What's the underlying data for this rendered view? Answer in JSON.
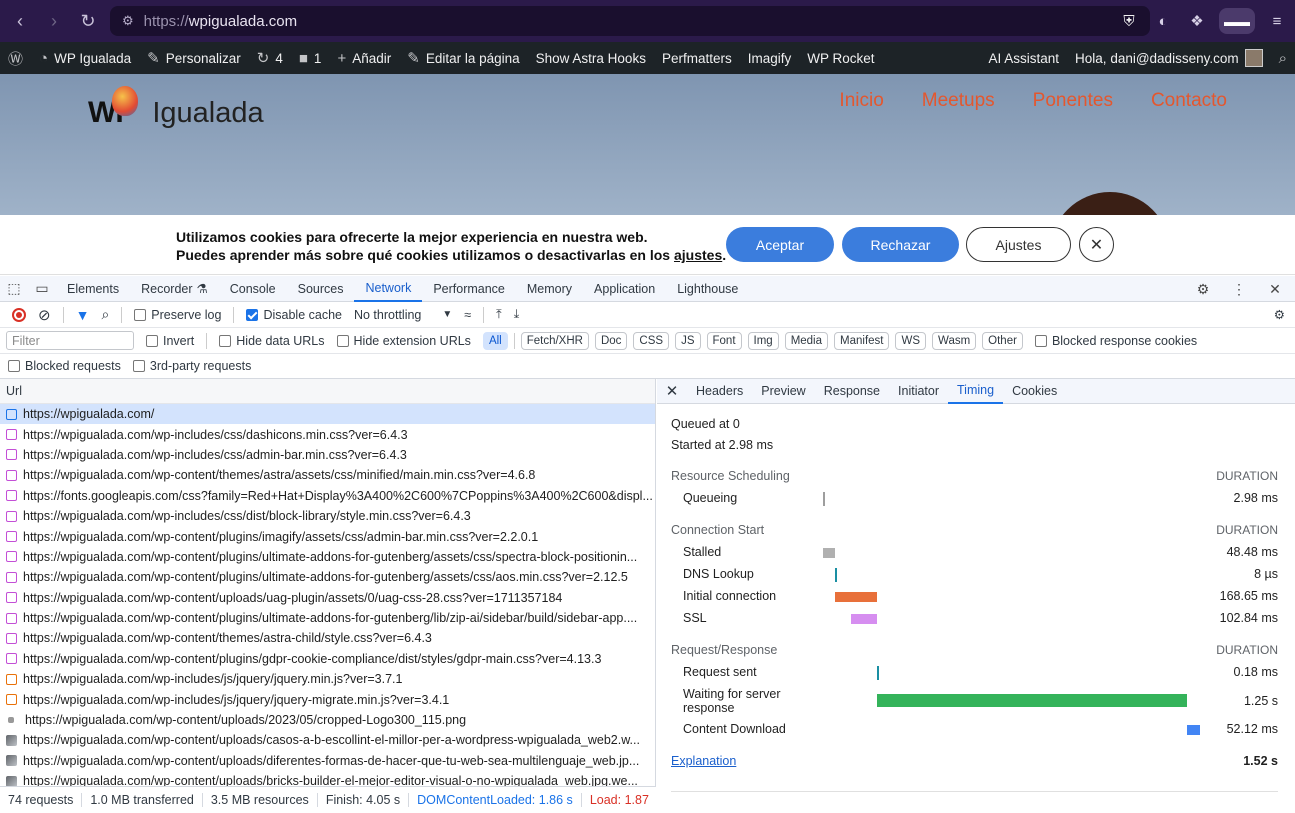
{
  "browser": {
    "url_scheme": "https://",
    "url_host": "wpigualada.com"
  },
  "wp_admin_bar": {
    "site_name": "WP Igualada",
    "customize": "Personalizar",
    "updates_count": "4",
    "comments_count": "1",
    "add_new": "Añadir",
    "edit_page": "Editar la página",
    "astra_hooks": "Show Astra Hooks",
    "perfmatters": "Perfmatters",
    "imagify": "Imagify",
    "wp_rocket": "WP Rocket",
    "ai_assistant": "AI Assistant",
    "greeting": "Hola, dani@dadisseny.com"
  },
  "site": {
    "logo_wp": "WP",
    "logo_name": "Igualada",
    "nav": [
      "Inicio",
      "Meetups",
      "Ponentes",
      "Contacto"
    ]
  },
  "cookie_banner": {
    "line1": "Utilizamos cookies para ofrecerte la mejor experiencia en nuestra web.",
    "line2_prefix": "Puedes aprender más sobre qué cookies utilizamos o desactivarlas en los ",
    "line2_link": "ajustes",
    "line2_suffix": ".",
    "accept": "Aceptar",
    "reject": "Rechazar",
    "settings": "Ajustes"
  },
  "devtools": {
    "tabs": [
      "Elements",
      "Recorder",
      "Console",
      "Sources",
      "Network",
      "Performance",
      "Memory",
      "Application",
      "Lighthouse"
    ],
    "active_tab": "Network",
    "toolbar": {
      "preserve_log": "Preserve log",
      "disable_cache": "Disable cache",
      "throttling": "No throttling"
    },
    "filter_bar": {
      "filter_placeholder": "Filter",
      "invert": "Invert",
      "hide_data_urls": "Hide data URLs",
      "hide_extension_urls": "Hide extension URLs",
      "types": [
        "All",
        "Fetch/XHR",
        "Doc",
        "CSS",
        "JS",
        "Font",
        "Img",
        "Media",
        "Manifest",
        "WS",
        "Wasm",
        "Other"
      ],
      "blocked_response_cookies": "Blocked response cookies",
      "blocked_requests": "Blocked requests",
      "third_party_requests": "3rd-party requests"
    },
    "requests_header": "Url",
    "requests": [
      {
        "type": "doc",
        "url": "https://wpigualada.com/"
      },
      {
        "type": "css",
        "url": "https://wpigualada.com/wp-includes/css/dashicons.min.css?ver=6.4.3"
      },
      {
        "type": "css",
        "url": "https://wpigualada.com/wp-includes/css/admin-bar.min.css?ver=6.4.3"
      },
      {
        "type": "css",
        "url": "https://wpigualada.com/wp-content/themes/astra/assets/css/minified/main.min.css?ver=4.6.8"
      },
      {
        "type": "css",
        "url": "https://fonts.googleapis.com/css?family=Red+Hat+Display%3A400%2C600%7CPoppins%3A400%2C600&displ..."
      },
      {
        "type": "css",
        "url": "https://wpigualada.com/wp-includes/css/dist/block-library/style.min.css?ver=6.4.3"
      },
      {
        "type": "css",
        "url": "https://wpigualada.com/wp-content/plugins/imagify/assets/css/admin-bar.min.css?ver=2.2.0.1"
      },
      {
        "type": "css",
        "url": "https://wpigualada.com/wp-content/plugins/ultimate-addons-for-gutenberg/assets/css/spectra-block-positionin..."
      },
      {
        "type": "css",
        "url": "https://wpigualada.com/wp-content/plugins/ultimate-addons-for-gutenberg/assets/css/aos.min.css?ver=2.12.5"
      },
      {
        "type": "css",
        "url": "https://wpigualada.com/wp-content/uploads/uag-plugin/assets/0/uag-css-28.css?ver=1711357184"
      },
      {
        "type": "css",
        "url": "https://wpigualada.com/wp-content/plugins/ultimate-addons-for-gutenberg/lib/zip-ai/sidebar/build/sidebar-app...."
      },
      {
        "type": "css",
        "url": "https://wpigualada.com/wp-content/themes/astra-child/style.css?ver=6.4.3"
      },
      {
        "type": "css",
        "url": "https://wpigualada.com/wp-content/plugins/gdpr-cookie-compliance/dist/styles/gdpr-main.css?ver=4.13.3"
      },
      {
        "type": "js",
        "url": "https://wpigualada.com/wp-includes/js/jquery/jquery.min.js?ver=3.7.1"
      },
      {
        "type": "js",
        "url": "https://wpigualada.com/wp-includes/js/jquery/jquery-migrate.min.js?ver=3.4.1"
      },
      {
        "type": "png",
        "url": "https://wpigualada.com/wp-content/uploads/2023/05/cropped-Logo300_115.png"
      },
      {
        "type": "img",
        "url": "https://wpigualada.com/wp-content/uploads/casos-a-b-escollint-el-millor-per-a-wordpress-wpigualada_web2.w..."
      },
      {
        "type": "img",
        "url": "https://wpigualada.com/wp-content/uploads/diferentes-formas-de-hacer-que-tu-web-sea-multilenguaje_web.jp..."
      },
      {
        "type": "img",
        "url": "https://wpigualada.com/wp-content/uploads/bricks-builder-el-mejor-editor-visual-o-no-wpigualada_web.jpg.we..."
      }
    ],
    "status": {
      "requests": "74 requests",
      "transferred": "1.0 MB transferred",
      "resources": "3.5 MB resources",
      "finish": "Finish: 4.05 s",
      "dcl": "DOMContentLoaded: 1.86 s",
      "load": "Load: 1.87"
    },
    "detail_tabs": [
      "Headers",
      "Preview",
      "Response",
      "Initiator",
      "Timing",
      "Cookies"
    ],
    "active_detail_tab": "Timing",
    "timing": {
      "queued_at": "Queued at 0",
      "started_at": "Started at 2.98 ms",
      "duration_label": "DURATION",
      "sections": [
        {
          "title": "Resource Scheduling",
          "rows": [
            {
              "label": "Queueing",
              "value": "2.98 ms",
              "color": "#9e9e9e"
            }
          ]
        },
        {
          "title": "Connection Start",
          "rows": [
            {
              "label": "Stalled",
              "value": "48.48 ms",
              "color": "#b0b0b0"
            },
            {
              "label": "DNS Lookup",
              "value": "8 µs",
              "color": "#1a8fa3"
            },
            {
              "label": "Initial connection",
              "value": "168.65 ms",
              "color": "#e8703a"
            },
            {
              "label": "SSL",
              "value": "102.84 ms",
              "color": "#d68ef0"
            }
          ]
        },
        {
          "title": "Request/Response",
          "rows": [
            {
              "label": "Request sent",
              "value": "0.18 ms",
              "color": "#1a8fa3"
            },
            {
              "label": "Waiting for server response",
              "value": "1.25 s",
              "color": "#34b35a"
            },
            {
              "label": "Content Download",
              "value": "52.12 ms",
              "color": "#4285f4"
            }
          ]
        }
      ],
      "explanation": "Explanation",
      "total": "1.52 s"
    }
  }
}
